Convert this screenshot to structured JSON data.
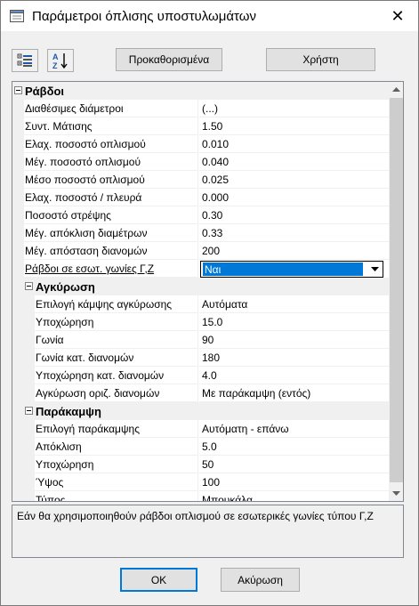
{
  "window": {
    "title": "Παράμετροι όπλισης υποστυλωμάτων",
    "close_symbol": "✕"
  },
  "toolbar": {
    "categorized_icon": "categorized-view-icon",
    "alphabetical_icon": "sort-az-icon",
    "defaults_label": "Προκαθορισμένα",
    "user_label": "Χρήστη"
  },
  "grid": {
    "sections": [
      {
        "label": "Ράβδοι",
        "rows": [
          {
            "name": "Διαθέσιμες διάμετροι",
            "value": "(...)"
          },
          {
            "name": "Συντ. Μάτισης",
            "value": "1.50"
          },
          {
            "name": "Ελαχ. ποσοστό οπλισμού",
            "value": "0.010"
          },
          {
            "name": "Μέγ. ποσοστό οπλισμού",
            "value": "0.040"
          },
          {
            "name": "Μέσο ποσοστό οπλισμού",
            "value": "0.025"
          },
          {
            "name": "Ελαχ. ποσοστό / πλευρά",
            "value": "0.000"
          },
          {
            "name": "Ποσοστό στρέψης",
            "value": "0.30"
          },
          {
            "name": "Μέγ. απόκλιση διαμέτρων",
            "value": "0.33"
          },
          {
            "name": "Μέγ. απόσταση διανομών",
            "value": "200"
          },
          {
            "name": "Ράβδοι σε εσωτ. γωνίες Γ,Ζ",
            "value": "Ναι"
          }
        ]
      },
      {
        "label": "Αγκύρωση",
        "rows": [
          {
            "name": "Επιλογή κάμψης αγκύρωσης",
            "value": "Αυτόματα"
          },
          {
            "name": "Υποχώρηση",
            "value": "15.0"
          },
          {
            "name": "Γωνία",
            "value": "90"
          },
          {
            "name": "Γωνία κατ. διανομών",
            "value": "180"
          },
          {
            "name": "Υποχώρηση κατ. διανομών",
            "value": "4.0"
          },
          {
            "name": "Αγκύρωση οριζ. διανομών",
            "value": "Με παράκαμψη (εντός)"
          }
        ]
      },
      {
        "label": "Παράκαμψη",
        "rows": [
          {
            "name": "Επιλογή παράκαμψης",
            "value": "Αυτόματη - επάνω"
          },
          {
            "name": "Απόκλιση",
            "value": "5.0"
          },
          {
            "name": "Υποχώρηση",
            "value": "50"
          },
          {
            "name": "Ύψος",
            "value": "100"
          },
          {
            "name": "Τύπος",
            "value": "Μπουκάλα"
          }
        ]
      }
    ]
  },
  "help_text": "Εάν θα χρησιμοποιηθούν ράβδοι οπλισμού σε εσωτερικές γωνίες τύπου Γ,Ζ",
  "buttons": {
    "ok_label": "ΟΚ",
    "cancel_label": "Ακύρωση"
  },
  "colors": {
    "selection": "#0078d7",
    "default_button_border": "#0078d7"
  }
}
